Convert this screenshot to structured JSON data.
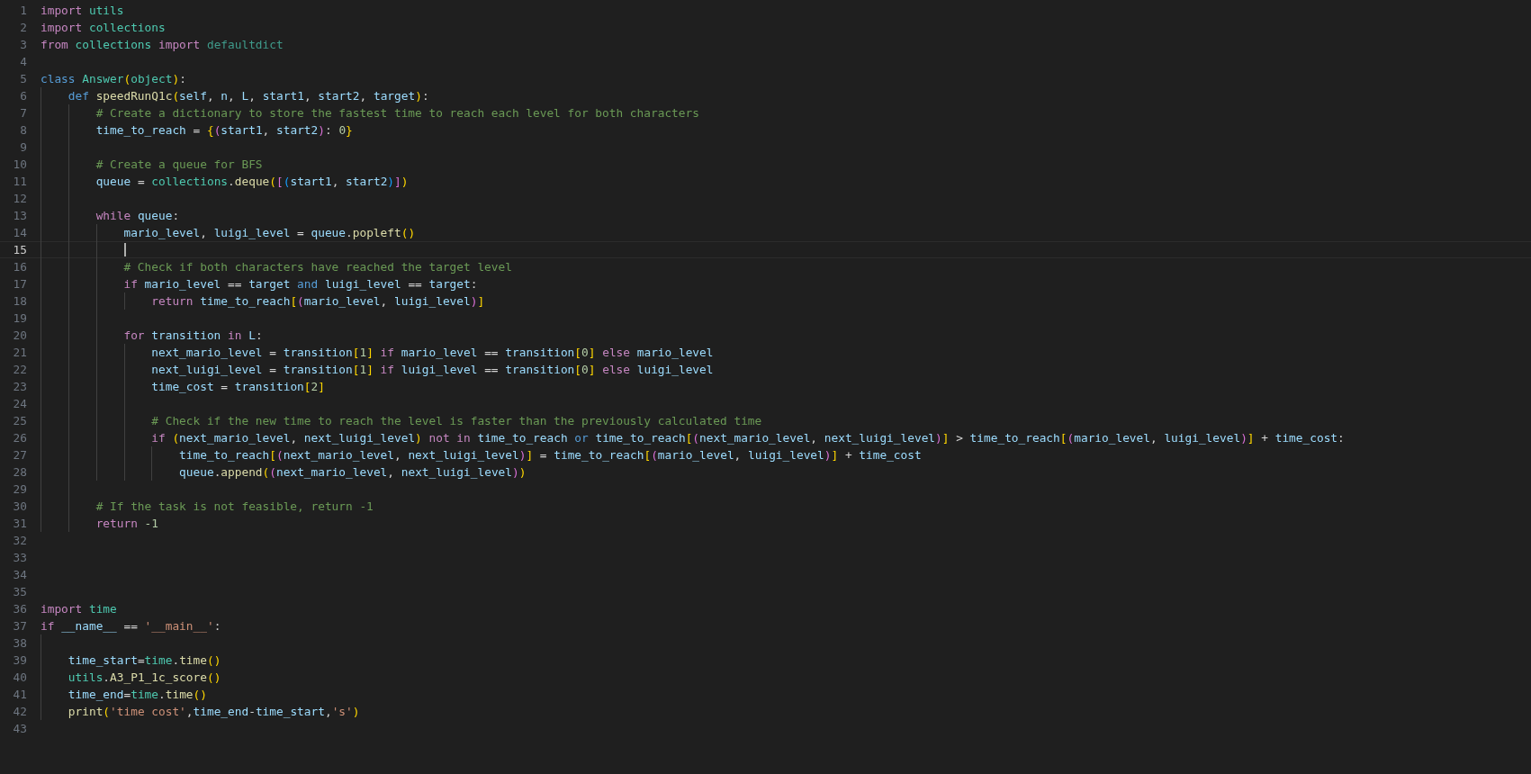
{
  "editor": {
    "lines": [
      {
        "number": "1",
        "current": false,
        "tokens": [
          {
            "kind": "kw",
            "text": "import "
          },
          {
            "kind": "type",
            "text": "utils"
          }
        ]
      },
      {
        "number": "2",
        "current": false,
        "tokens": [
          {
            "kind": "kw",
            "text": "import "
          },
          {
            "kind": "type",
            "text": "collections"
          }
        ]
      },
      {
        "number": "3",
        "current": false,
        "tokens": [
          {
            "kind": "kw",
            "text": "from "
          },
          {
            "kind": "type",
            "text": "collections "
          },
          {
            "kind": "kw",
            "text": "import "
          },
          {
            "kind": "type2",
            "text": "defaultdict"
          }
        ]
      },
      {
        "number": "4",
        "current": false
      },
      {
        "number": "5",
        "current": false,
        "tokens": [
          {
            "kind": "decl",
            "text": "class "
          },
          {
            "kind": "type",
            "text": "Answer"
          },
          {
            "kind": "b1",
            "text": "("
          },
          {
            "kind": "type",
            "text": "object"
          },
          {
            "kind": "b1",
            "text": ")"
          },
          {
            "kind": "op",
            "text": ":"
          }
        ]
      },
      {
        "number": "6",
        "current": false,
        "tokens": [
          {
            "kind": "decl",
            "text": "    def "
          },
          {
            "kind": "fn",
            "text": "speedRunQ1c"
          },
          {
            "kind": "b1",
            "text": "("
          },
          {
            "kind": "var",
            "text": "self"
          },
          {
            "kind": "op",
            "text": ", "
          },
          {
            "kind": "var",
            "text": "n"
          },
          {
            "kind": "op",
            "text": ", "
          },
          {
            "kind": "var",
            "text": "L"
          },
          {
            "kind": "op",
            "text": ", "
          },
          {
            "kind": "var",
            "text": "start1"
          },
          {
            "kind": "op",
            "text": ", "
          },
          {
            "kind": "var",
            "text": "start2"
          },
          {
            "kind": "op",
            "text": ", "
          },
          {
            "kind": "var",
            "text": "target"
          },
          {
            "kind": "b1",
            "text": ")"
          },
          {
            "kind": "op",
            "text": ":"
          }
        ]
      },
      {
        "number": "7",
        "current": false,
        "tokens": [
          {
            "kind": "cmt",
            "text": "        # Create a dictionary to store the fastest time to reach each level for both characters"
          }
        ]
      },
      {
        "number": "8",
        "current": false,
        "tokens": [
          {
            "kind": "var",
            "text": "        time_to_reach"
          },
          {
            "kind": "op",
            "text": " = "
          },
          {
            "kind": "b1",
            "text": "{"
          },
          {
            "kind": "b2",
            "text": "("
          },
          {
            "kind": "var",
            "text": "start1"
          },
          {
            "kind": "op",
            "text": ", "
          },
          {
            "kind": "var",
            "text": "start2"
          },
          {
            "kind": "b2",
            "text": ")"
          },
          {
            "kind": "op",
            "text": ": "
          },
          {
            "kind": "num",
            "text": "0"
          },
          {
            "kind": "b1",
            "text": "}"
          }
        ]
      },
      {
        "number": "9",
        "current": false
      },
      {
        "number": "10",
        "current": false,
        "tokens": [
          {
            "kind": "cmt",
            "text": "        # Create a queue for BFS"
          }
        ]
      },
      {
        "number": "11",
        "current": false,
        "tokens": [
          {
            "kind": "var",
            "text": "        queue"
          },
          {
            "kind": "op",
            "text": " = "
          },
          {
            "kind": "type",
            "text": "collections"
          },
          {
            "kind": "op",
            "text": "."
          },
          {
            "kind": "fn",
            "text": "deque"
          },
          {
            "kind": "b1",
            "text": "("
          },
          {
            "kind": "b2",
            "text": "["
          },
          {
            "kind": "b3",
            "text": "("
          },
          {
            "kind": "var",
            "text": "start1"
          },
          {
            "kind": "op",
            "text": ", "
          },
          {
            "kind": "var",
            "text": "start2"
          },
          {
            "kind": "b3",
            "text": ")"
          },
          {
            "kind": "b2",
            "text": "]"
          },
          {
            "kind": "b1",
            "text": ")"
          }
        ]
      },
      {
        "number": "12",
        "current": false
      },
      {
        "number": "13",
        "current": false,
        "tokens": [
          {
            "kind": "kw",
            "text": "        while "
          },
          {
            "kind": "var",
            "text": "queue"
          },
          {
            "kind": "op",
            "text": ":"
          }
        ]
      },
      {
        "number": "14",
        "current": false,
        "tokens": [
          {
            "kind": "var",
            "text": "            mario_level"
          },
          {
            "kind": "op",
            "text": ", "
          },
          {
            "kind": "var",
            "text": "luigi_level"
          },
          {
            "kind": "op",
            "text": " = "
          },
          {
            "kind": "var",
            "text": "queue"
          },
          {
            "kind": "op",
            "text": "."
          },
          {
            "kind": "fn",
            "text": "popleft"
          },
          {
            "kind": "b1",
            "text": "()"
          }
        ]
      },
      {
        "number": "15",
        "current": true
      },
      {
        "number": "16",
        "current": false,
        "tokens": [
          {
            "kind": "cmt",
            "text": "            # Check if both characters have reached the target level"
          }
        ]
      },
      {
        "number": "17",
        "current": false,
        "tokens": [
          {
            "kind": "kw",
            "text": "            if "
          },
          {
            "kind": "var",
            "text": "mario_level"
          },
          {
            "kind": "op",
            "text": " == "
          },
          {
            "kind": "var",
            "text": "target"
          },
          {
            "kind": "decl",
            "text": " and "
          },
          {
            "kind": "var",
            "text": "luigi_level"
          },
          {
            "kind": "op",
            "text": " == "
          },
          {
            "kind": "var",
            "text": "target"
          },
          {
            "kind": "op",
            "text": ":"
          }
        ]
      },
      {
        "number": "18",
        "current": false,
        "tokens": [
          {
            "kind": "kw",
            "text": "                return "
          },
          {
            "kind": "var",
            "text": "time_to_reach"
          },
          {
            "kind": "b1",
            "text": "["
          },
          {
            "kind": "b2",
            "text": "("
          },
          {
            "kind": "var",
            "text": "mario_level"
          },
          {
            "kind": "op",
            "text": ", "
          },
          {
            "kind": "var",
            "text": "luigi_level"
          },
          {
            "kind": "b2",
            "text": ")"
          },
          {
            "kind": "b1",
            "text": "]"
          }
        ]
      },
      {
        "number": "19",
        "current": false
      },
      {
        "number": "20",
        "current": false,
        "tokens": [
          {
            "kind": "kw",
            "text": "            for "
          },
          {
            "kind": "var",
            "text": "transition"
          },
          {
            "kind": "kw",
            "text": " in "
          },
          {
            "kind": "var",
            "text": "L"
          },
          {
            "kind": "op",
            "text": ":"
          }
        ]
      },
      {
        "number": "21",
        "current": false,
        "tokens": [
          {
            "kind": "var",
            "text": "                next_mario_level"
          },
          {
            "kind": "op",
            "text": " = "
          },
          {
            "kind": "var",
            "text": "transition"
          },
          {
            "kind": "b1",
            "text": "["
          },
          {
            "kind": "num",
            "text": "1"
          },
          {
            "kind": "b1",
            "text": "]"
          },
          {
            "kind": "kw",
            "text": " if "
          },
          {
            "kind": "var",
            "text": "mario_level"
          },
          {
            "kind": "op",
            "text": " == "
          },
          {
            "kind": "var",
            "text": "transition"
          },
          {
            "kind": "b1",
            "text": "["
          },
          {
            "kind": "num",
            "text": "0"
          },
          {
            "kind": "b1",
            "text": "]"
          },
          {
            "kind": "kw",
            "text": " else "
          },
          {
            "kind": "var",
            "text": "mario_level"
          }
        ]
      },
      {
        "number": "22",
        "current": false,
        "tokens": [
          {
            "kind": "var",
            "text": "                next_luigi_level"
          },
          {
            "kind": "op",
            "text": " = "
          },
          {
            "kind": "var",
            "text": "transition"
          },
          {
            "kind": "b1",
            "text": "["
          },
          {
            "kind": "num",
            "text": "1"
          },
          {
            "kind": "b1",
            "text": "]"
          },
          {
            "kind": "kw",
            "text": " if "
          },
          {
            "kind": "var",
            "text": "luigi_level"
          },
          {
            "kind": "op",
            "text": " == "
          },
          {
            "kind": "var",
            "text": "transition"
          },
          {
            "kind": "b1",
            "text": "["
          },
          {
            "kind": "num",
            "text": "0"
          },
          {
            "kind": "b1",
            "text": "]"
          },
          {
            "kind": "kw",
            "text": " else "
          },
          {
            "kind": "var",
            "text": "luigi_level"
          }
        ]
      },
      {
        "number": "23",
        "current": false,
        "tokens": [
          {
            "kind": "var",
            "text": "                time_cost"
          },
          {
            "kind": "op",
            "text": " = "
          },
          {
            "kind": "var",
            "text": "transition"
          },
          {
            "kind": "b1",
            "text": "["
          },
          {
            "kind": "num",
            "text": "2"
          },
          {
            "kind": "b1",
            "text": "]"
          }
        ]
      },
      {
        "number": "24",
        "current": false
      },
      {
        "number": "25",
        "current": false,
        "tokens": [
          {
            "kind": "cmt",
            "text": "                # Check if the new time to reach the level is faster than the previously calculated time"
          }
        ]
      },
      {
        "number": "26",
        "current": false,
        "tokens": [
          {
            "kind": "kw",
            "text": "                if "
          },
          {
            "kind": "b1",
            "text": "("
          },
          {
            "kind": "var",
            "text": "next_mario_level"
          },
          {
            "kind": "op",
            "text": ", "
          },
          {
            "kind": "var",
            "text": "next_luigi_level"
          },
          {
            "kind": "b1",
            "text": ")"
          },
          {
            "kind": "kw",
            "text": " not in "
          },
          {
            "kind": "var",
            "text": "time_to_reach"
          },
          {
            "kind": "decl",
            "text": " or "
          },
          {
            "kind": "var",
            "text": "time_to_reach"
          },
          {
            "kind": "b1",
            "text": "["
          },
          {
            "kind": "b2",
            "text": "("
          },
          {
            "kind": "var",
            "text": "next_mario_level"
          },
          {
            "kind": "op",
            "text": ", "
          },
          {
            "kind": "var",
            "text": "next_luigi_level"
          },
          {
            "kind": "b2",
            "text": ")"
          },
          {
            "kind": "b1",
            "text": "]"
          },
          {
            "kind": "op",
            "text": " > "
          },
          {
            "kind": "var",
            "text": "time_to_reach"
          },
          {
            "kind": "b1",
            "text": "["
          },
          {
            "kind": "b2",
            "text": "("
          },
          {
            "kind": "var",
            "text": "mario_level"
          },
          {
            "kind": "op",
            "text": ", "
          },
          {
            "kind": "var",
            "text": "luigi_level"
          },
          {
            "kind": "b2",
            "text": ")"
          },
          {
            "kind": "b1",
            "text": "]"
          },
          {
            "kind": "op",
            "text": " + "
          },
          {
            "kind": "var",
            "text": "time_cost"
          },
          {
            "kind": "op",
            "text": ":"
          }
        ]
      },
      {
        "number": "27",
        "current": false,
        "tokens": [
          {
            "kind": "var",
            "text": "                    time_to_reach"
          },
          {
            "kind": "b1",
            "text": "["
          },
          {
            "kind": "b2",
            "text": "("
          },
          {
            "kind": "var",
            "text": "next_mario_level"
          },
          {
            "kind": "op",
            "text": ", "
          },
          {
            "kind": "var",
            "text": "next_luigi_level"
          },
          {
            "kind": "b2",
            "text": ")"
          },
          {
            "kind": "b1",
            "text": "]"
          },
          {
            "kind": "op",
            "text": " = "
          },
          {
            "kind": "var",
            "text": "time_to_reach"
          },
          {
            "kind": "b1",
            "text": "["
          },
          {
            "kind": "b2",
            "text": "("
          },
          {
            "kind": "var",
            "text": "mario_level"
          },
          {
            "kind": "op",
            "text": ", "
          },
          {
            "kind": "var",
            "text": "luigi_level"
          },
          {
            "kind": "b2",
            "text": ")"
          },
          {
            "kind": "b1",
            "text": "]"
          },
          {
            "kind": "op",
            "text": " + "
          },
          {
            "kind": "var",
            "text": "time_cost"
          }
        ]
      },
      {
        "number": "28",
        "current": false,
        "tokens": [
          {
            "kind": "var",
            "text": "                    queue"
          },
          {
            "kind": "op",
            "text": "."
          },
          {
            "kind": "fn",
            "text": "append"
          },
          {
            "kind": "b1",
            "text": "("
          },
          {
            "kind": "b2",
            "text": "("
          },
          {
            "kind": "var",
            "text": "next_mario_level"
          },
          {
            "kind": "op",
            "text": ", "
          },
          {
            "kind": "var",
            "text": "next_luigi_level"
          },
          {
            "kind": "b2",
            "text": ")"
          },
          {
            "kind": "b1",
            "text": ")"
          }
        ]
      },
      {
        "number": "29",
        "current": false
      },
      {
        "number": "30",
        "current": false,
        "tokens": [
          {
            "kind": "cmt",
            "text": "        # If the task is not feasible, return -1"
          }
        ]
      },
      {
        "number": "31",
        "current": false,
        "tokens": [
          {
            "kind": "kw",
            "text": "        return "
          },
          {
            "kind": "num",
            "text": "-1"
          }
        ]
      },
      {
        "number": "32",
        "current": false
      },
      {
        "number": "33",
        "current": false
      },
      {
        "number": "34",
        "current": false
      },
      {
        "number": "35",
        "current": false
      },
      {
        "number": "36",
        "current": false,
        "tokens": [
          {
            "kind": "kw",
            "text": "import "
          },
          {
            "kind": "type",
            "text": "time"
          }
        ]
      },
      {
        "number": "37",
        "current": false,
        "tokens": [
          {
            "kind": "kw",
            "text": "if "
          },
          {
            "kind": "var",
            "text": "__name__"
          },
          {
            "kind": "op",
            "text": " == "
          },
          {
            "kind": "str",
            "text": "'__main__'"
          },
          {
            "kind": "op",
            "text": ":"
          }
        ]
      },
      {
        "number": "38",
        "current": false
      },
      {
        "number": "39",
        "current": false,
        "tokens": [
          {
            "kind": "var",
            "text": "    time_start"
          },
          {
            "kind": "op",
            "text": "="
          },
          {
            "kind": "type",
            "text": "time"
          },
          {
            "kind": "op",
            "text": "."
          },
          {
            "kind": "fn",
            "text": "time"
          },
          {
            "kind": "b1",
            "text": "()"
          }
        ]
      },
      {
        "number": "40",
        "current": false,
        "tokens": [
          {
            "kind": "type",
            "text": "    utils"
          },
          {
            "kind": "op",
            "text": "."
          },
          {
            "kind": "fn",
            "text": "A3_P1_1c_score"
          },
          {
            "kind": "b1",
            "text": "()"
          }
        ]
      },
      {
        "number": "41",
        "current": false,
        "tokens": [
          {
            "kind": "var",
            "text": "    time_end"
          },
          {
            "kind": "op",
            "text": "="
          },
          {
            "kind": "type",
            "text": "time"
          },
          {
            "kind": "op",
            "text": "."
          },
          {
            "kind": "fn",
            "text": "time"
          },
          {
            "kind": "b1",
            "text": "()"
          }
        ]
      },
      {
        "number": "42",
        "current": false,
        "tokens": [
          {
            "kind": "fn",
            "text": "    print"
          },
          {
            "kind": "b1",
            "text": "("
          },
          {
            "kind": "str",
            "text": "'time cost'"
          },
          {
            "kind": "op",
            "text": ","
          },
          {
            "kind": "var",
            "text": "time_end"
          },
          {
            "kind": "op",
            "text": "-"
          },
          {
            "kind": "var",
            "text": "time_start"
          },
          {
            "kind": "op",
            "text": ","
          },
          {
            "kind": "str",
            "text": "'s'"
          },
          {
            "kind": "b1",
            "text": ")"
          }
        ]
      },
      {
        "number": "43",
        "current": false
      }
    ]
  }
}
